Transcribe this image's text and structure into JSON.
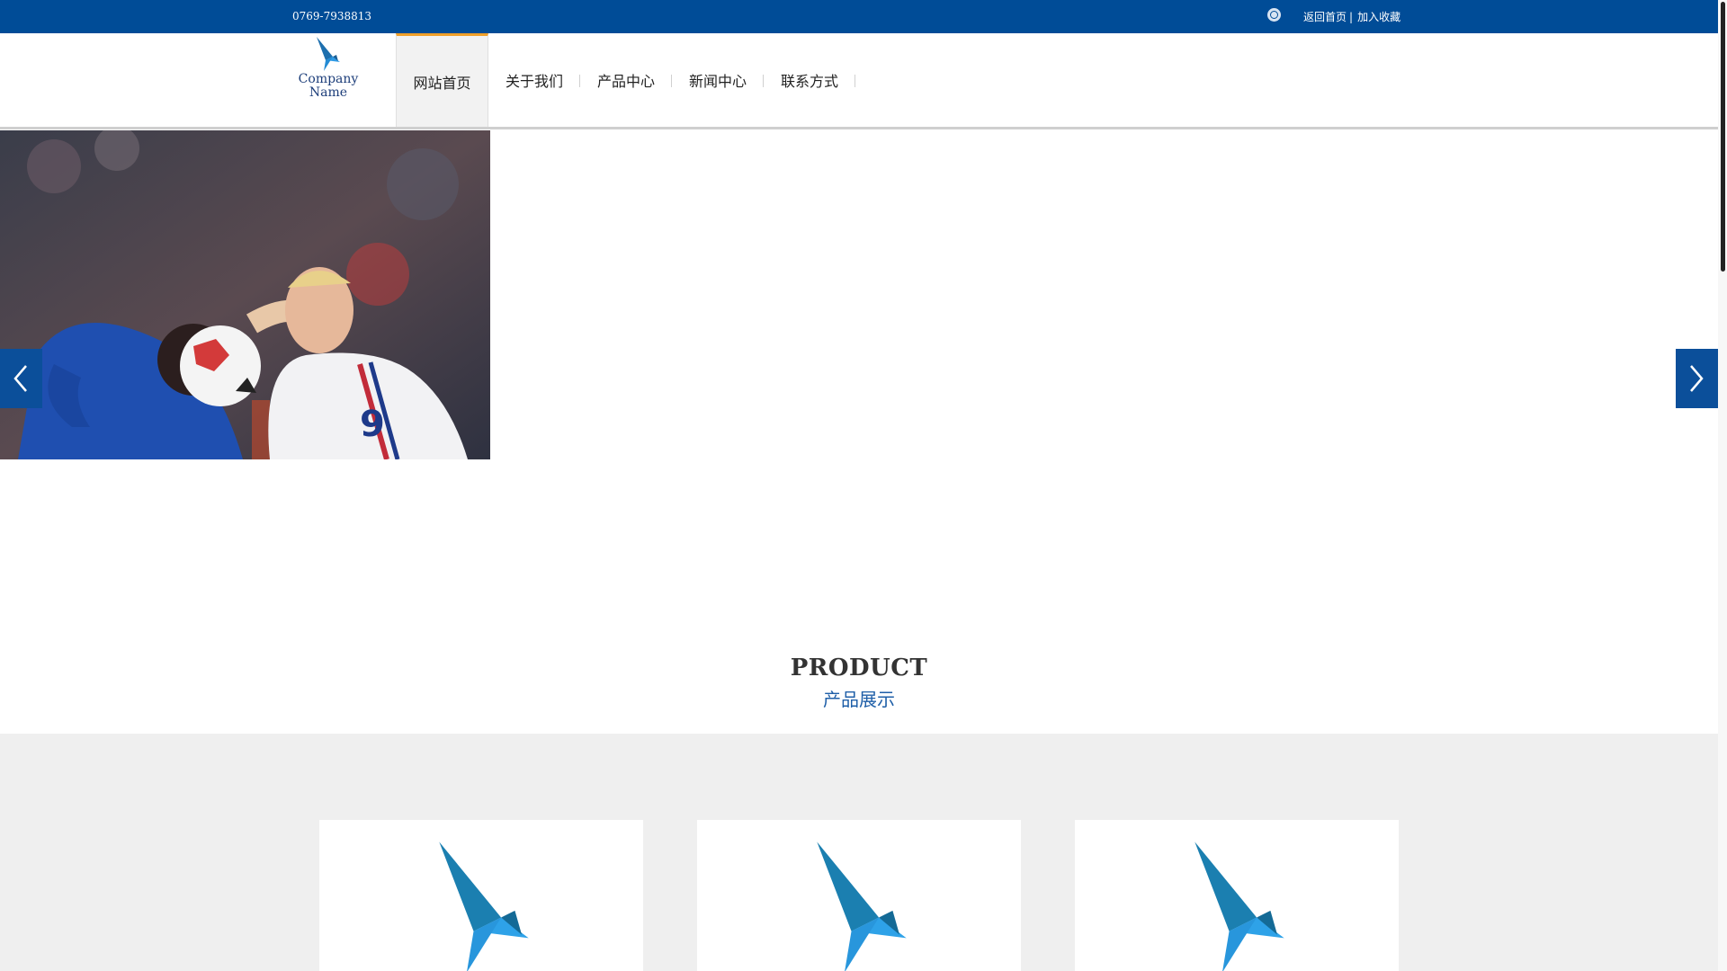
{
  "topbar": {
    "phone": "0769-7938813",
    "globe_icon": "globe-icon",
    "home_link": "返回首页",
    "separator": "|",
    "favorite_link": "加入收藏"
  },
  "logo": {
    "icon": "bird-logo-icon",
    "line1": "Company",
    "line2": "Name"
  },
  "nav": {
    "items": [
      {
        "label": "网站首页",
        "active": true
      },
      {
        "label": "关于我们"
      },
      {
        "label": "产品中心"
      },
      {
        "label": "新闻中心"
      },
      {
        "label": "联系方式"
      }
    ]
  },
  "banner": {
    "image": "football-players-heading-ball-photo",
    "prev_icon": "chevron-left-icon",
    "next_icon": "chevron-right-icon"
  },
  "product_section": {
    "title": "PRODUCT",
    "subtitle": "产品展示",
    "cards": [
      {
        "image": "bird-logo-icon"
      },
      {
        "image": "bird-logo-icon"
      },
      {
        "image": "bird-logo-icon"
      }
    ]
  },
  "colors": {
    "topbar": "#004c97",
    "accent": "#f0a02a",
    "arrow": "#0b4f9a",
    "subtitle": "#1f5fa8",
    "section_bg": "#efefef"
  }
}
